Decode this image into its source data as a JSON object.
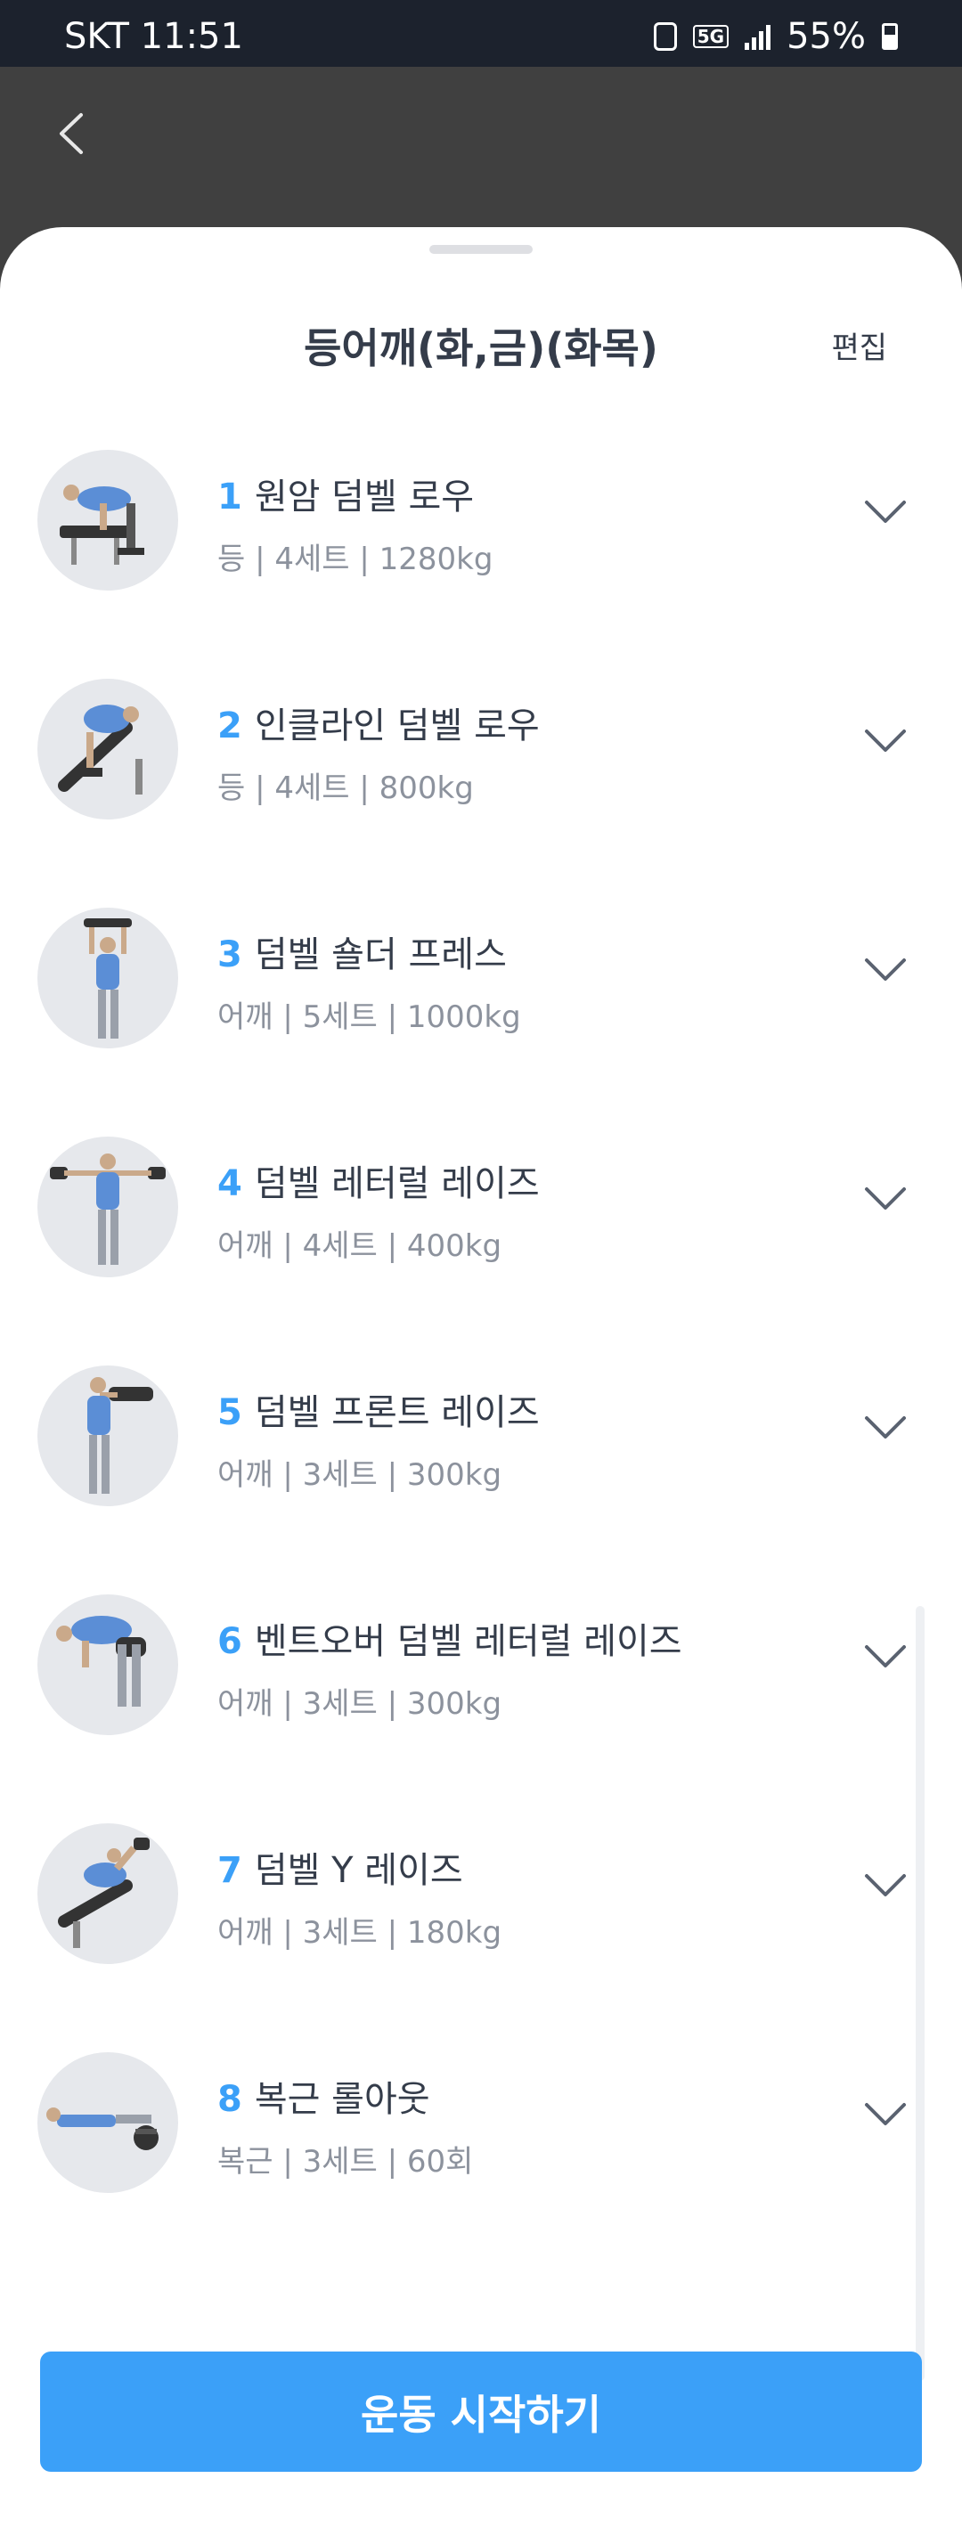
{
  "status_bar": {
    "carrier_time": "SKT 11:51",
    "network": "5G",
    "battery": "55%"
  },
  "sheet": {
    "title": "등어깨(화,금)(화목)",
    "edit_label": "편집"
  },
  "exercises": [
    {
      "num": "1",
      "name": "원암 덤벨 로우",
      "meta": "등 | 4세트 | 1280kg"
    },
    {
      "num": "2",
      "name": "인클라인 덤벨 로우",
      "meta": "등 | 4세트 | 800kg"
    },
    {
      "num": "3",
      "name": "덤벨 숄더 프레스",
      "meta": "어깨 | 5세트 | 1000kg"
    },
    {
      "num": "4",
      "name": "덤벨 레터럴 레이즈",
      "meta": "어깨 | 4세트 | 400kg"
    },
    {
      "num": "5",
      "name": "덤벨 프론트 레이즈",
      "meta": "어깨 | 3세트 | 300kg"
    },
    {
      "num": "6",
      "name": "벤트오버 덤벨 레터럴 레이즈",
      "meta": "어깨 | 3세트 | 300kg"
    },
    {
      "num": "7",
      "name": "덤벨 Y 레이즈",
      "meta": "어깨 | 3세트 | 180kg"
    },
    {
      "num": "8",
      "name": "복근 롤아웃",
      "meta": "복근 | 3세트 | 60회"
    }
  ],
  "start_button": "운동 시작하기",
  "colors": {
    "accent": "#3ba0f8",
    "text_primary": "#343c4a",
    "text_secondary": "#8c929d",
    "thumb_bg": "#e6e8ec"
  }
}
